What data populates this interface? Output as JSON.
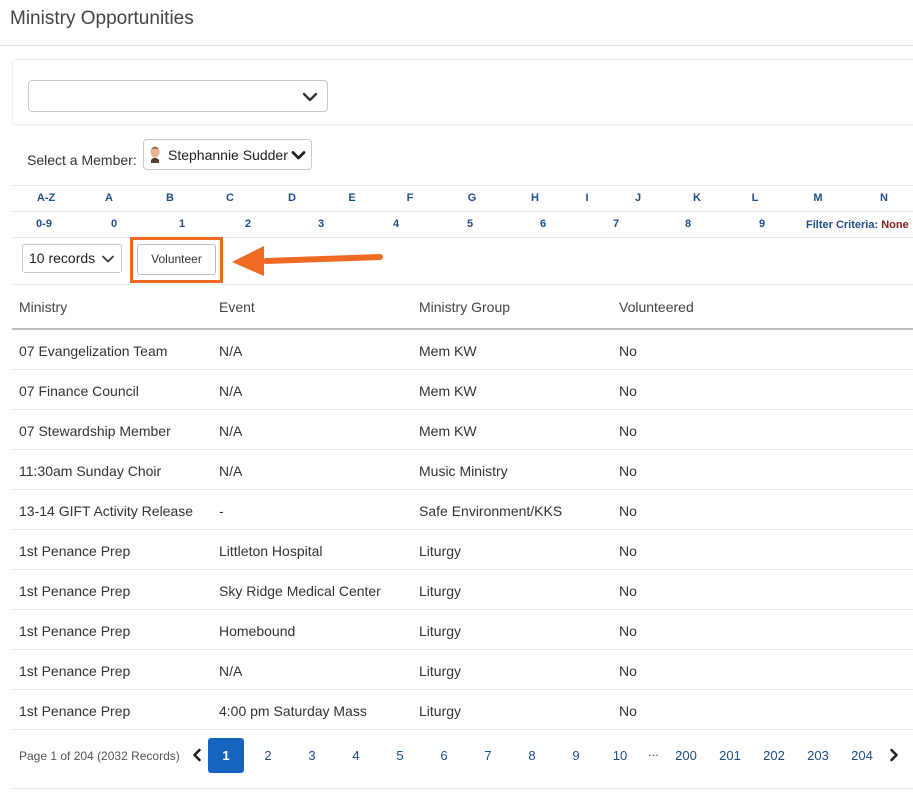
{
  "page": {
    "title": "Ministry Opportunities"
  },
  "member": {
    "label": "Select a Member:",
    "selected": "Stephannie Sudder"
  },
  "alpha_letters": [
    "A-Z",
    "A",
    "B",
    "C",
    "D",
    "E",
    "F",
    "G",
    "H",
    "I",
    "J",
    "K",
    "L",
    "M",
    "N"
  ],
  "alpha_digits": [
    "0-9",
    "0",
    "1",
    "2",
    "3",
    "4",
    "5",
    "6",
    "7",
    "8",
    "9"
  ],
  "filter": {
    "label": "Filter Criteria:",
    "value": "None"
  },
  "toolbar": {
    "records_label": "10 records",
    "volunteer_label": "Volunteer"
  },
  "table": {
    "columns": [
      "Ministry",
      "Event",
      "Ministry Group",
      "Volunteered"
    ],
    "rows": [
      [
        "07 Evangelization Team",
        "N/A",
        "Mem KW",
        "No"
      ],
      [
        "07 Finance Council",
        "N/A",
        "Mem KW",
        "No"
      ],
      [
        "07 Stewardship Member",
        "N/A",
        "Mem KW",
        "No"
      ],
      [
        "11:30am Sunday Choir",
        "N/A",
        "Music Ministry",
        "No"
      ],
      [
        "13-14 GIFT Activity Release",
        "-",
        "Safe Environment/KKS",
        "No"
      ],
      [
        "1st Penance Prep",
        "Littleton Hospital",
        "Liturgy",
        "No"
      ],
      [
        "1st Penance Prep",
        "Sky Ridge Medical Center",
        "Liturgy",
        "No"
      ],
      [
        "1st Penance Prep",
        "Homebound",
        "Liturgy",
        "No"
      ],
      [
        "1st Penance Prep",
        "N/A",
        "Liturgy",
        "No"
      ],
      [
        "1st Penance Prep",
        "4:00 pm Saturday Mass",
        "Liturgy",
        "No"
      ]
    ]
  },
  "pagination": {
    "info": "Page 1 of 204 (2032 Records)",
    "current": "1",
    "pages_first": [
      "2",
      "3",
      "4",
      "5",
      "6",
      "7",
      "8",
      "9",
      "10"
    ],
    "ellipsis": "...",
    "pages_last": [
      "200",
      "201",
      "202",
      "203",
      "204"
    ]
  },
  "colors": {
    "accent": "#1565c0",
    "highlight": "#f06a24",
    "link": "#1f4f87",
    "filter_value": "#8a1b1b"
  }
}
